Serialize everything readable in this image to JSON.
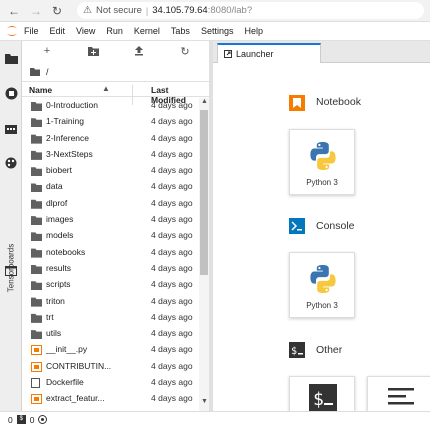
{
  "browser": {
    "back": "←",
    "forward": "→",
    "reload": "↻",
    "security": "Not secure",
    "url_host": "34.105.79.64",
    "url_rest": ":8080/lab?"
  },
  "menu": [
    "File",
    "Edit",
    "View",
    "Run",
    "Kernel",
    "Tabs",
    "Settings",
    "Help"
  ],
  "sidebar": {
    "tensorboards_label": "Tensorboards"
  },
  "filebrowser": {
    "breadcrumb": "/",
    "columns": {
      "name": "Name",
      "modified": "Last Modified"
    },
    "files": [
      {
        "name": "0-Introduction",
        "modified": "4 days ago",
        "type": "folder"
      },
      {
        "name": "1-Training",
        "modified": "4 days ago",
        "type": "folder"
      },
      {
        "name": "2-Inference",
        "modified": "4 days ago",
        "type": "folder"
      },
      {
        "name": "3-NextSteps",
        "modified": "4 days ago",
        "type": "folder"
      },
      {
        "name": "biobert",
        "modified": "4 days ago",
        "type": "folder"
      },
      {
        "name": "data",
        "modified": "4 days ago",
        "type": "folder"
      },
      {
        "name": "dlprof",
        "modified": "4 days ago",
        "type": "folder"
      },
      {
        "name": "images",
        "modified": "4 days ago",
        "type": "folder"
      },
      {
        "name": "models",
        "modified": "4 days ago",
        "type": "folder"
      },
      {
        "name": "notebooks",
        "modified": "4 days ago",
        "type": "folder"
      },
      {
        "name": "results",
        "modified": "4 days ago",
        "type": "folder"
      },
      {
        "name": "scripts",
        "modified": "4 days ago",
        "type": "folder"
      },
      {
        "name": "triton",
        "modified": "4 days ago",
        "type": "folder"
      },
      {
        "name": "trt",
        "modified": "4 days ago",
        "type": "folder"
      },
      {
        "name": "utils",
        "modified": "4 days ago",
        "type": "folder"
      },
      {
        "name": "__init__.py",
        "modified": "4 days ago",
        "type": "py"
      },
      {
        "name": "CONTRIBUTIN...",
        "modified": "4 days ago",
        "type": "md"
      },
      {
        "name": "Dockerfile",
        "modified": "4 days ago",
        "type": "txt"
      },
      {
        "name": "extract_featur...",
        "modified": "4 days ago",
        "type": "py"
      }
    ]
  },
  "launcher": {
    "tab_label": "Launcher",
    "sections": {
      "notebook": "Notebook",
      "console": "Console",
      "other": "Other"
    },
    "kernel_label": "Python 3"
  },
  "status": {
    "count1": "0",
    "count2": "0"
  },
  "colors": {
    "accent": "#1976d2",
    "orange": "#f57c00"
  }
}
